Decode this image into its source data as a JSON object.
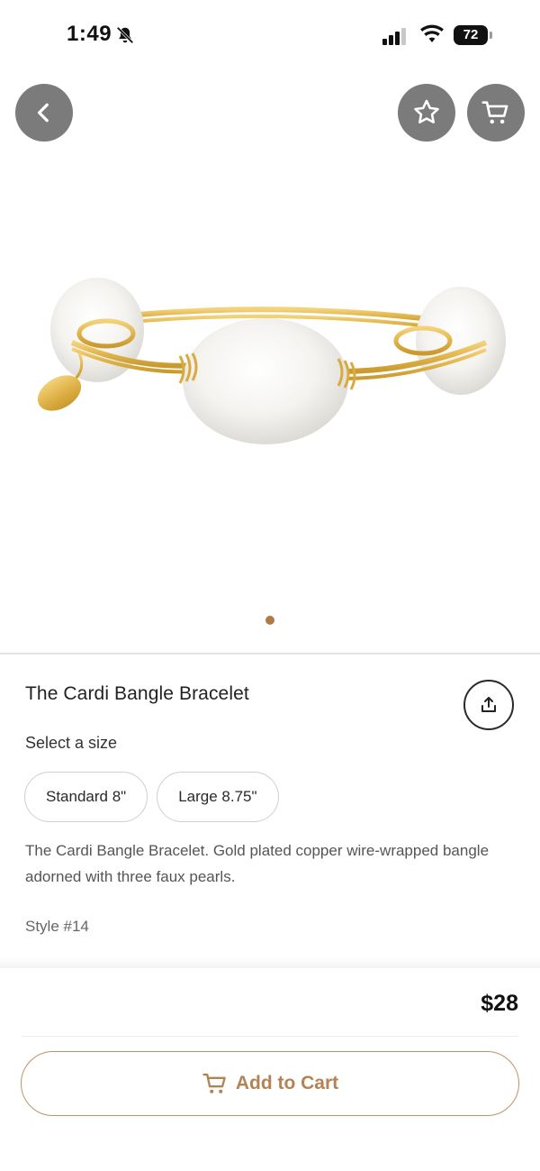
{
  "status_bar": {
    "time": "1:49",
    "battery_level": "72",
    "icons": [
      "bell-slash-icon",
      "signal-icon",
      "wifi-icon",
      "battery-icon"
    ]
  },
  "top_controls": {
    "back_icon": "chevron-left-icon",
    "favorite_icon": "star-outline-icon",
    "cart_icon": "cart-icon",
    "button_color": "#7b7b7b"
  },
  "product": {
    "title": "The Cardi Bangle Bracelet",
    "share_icon": "share-upload-icon",
    "select_size_label": "Select a size",
    "sizes": [
      {
        "label": "Standard 8\""
      },
      {
        "label": "Large 8.75\""
      }
    ],
    "description": "The Cardi Bangle Bracelet. Gold plated copper wire-wrapped bangle adorned with three faux pearls.",
    "style_number": "Style #14",
    "image_count": 1,
    "active_image_index": 1
  },
  "purchase": {
    "price": "$28",
    "add_to_cart_label": "Add to Cart",
    "accent_color": "#b48354"
  }
}
